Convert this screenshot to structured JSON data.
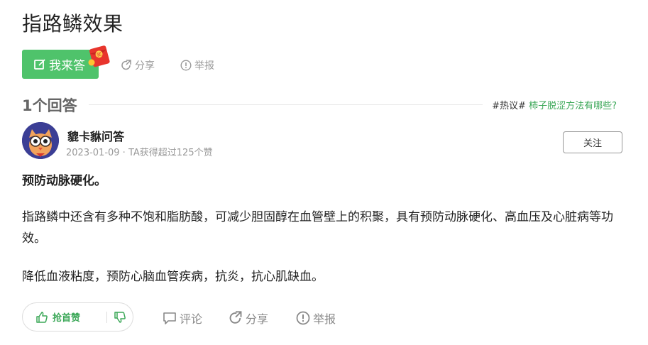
{
  "question": {
    "title": "指路鳞效果"
  },
  "actions": {
    "answer_label": "我来答",
    "share_label": "分享",
    "report_label": "举报"
  },
  "answers_header": {
    "count_label": "1个回答",
    "hot_tag": "#热议#",
    "hot_link": "柿子脱涩方法有哪些?"
  },
  "answer": {
    "author": "貔卡貅问答",
    "meta": "2023-01-09 · TA获得超过125个赞",
    "follow_label": "关注",
    "headline": "预防动脉硬化。",
    "paragraph_1": "指路鳞中还含有多种不饱和脂肪酸，可减少胆固醇在血管壁上的积聚，具有预防动脉硬化、高血压及心脏病等功效。",
    "paragraph_2": "降低血液粘度，预防心脑血管疾病，抗炎，抗心肌缺血。"
  },
  "footer": {
    "upvote_label": "抢首赞",
    "comment_label": "评论",
    "share_label": "分享",
    "report_label": "举报"
  },
  "colors": {
    "accent": "#4fc36b",
    "link": "#3aa757",
    "redpacket": "#e8352d"
  }
}
